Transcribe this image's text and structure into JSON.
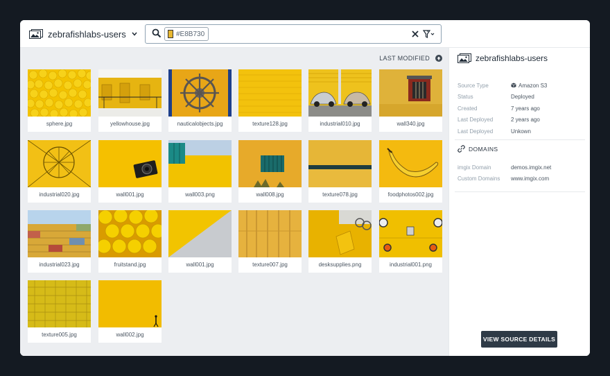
{
  "source": {
    "name": "zebrafishlabs-users",
    "switcher_icon": "images-icon"
  },
  "search": {
    "chip_label": "#E8B730",
    "chip_color": "#E8B730"
  },
  "sort": {
    "label": "LAST MODIFIED"
  },
  "images": [
    {
      "name": "sphere.jpg"
    },
    {
      "name": "yellowhouse.jpg"
    },
    {
      "name": "nauticalobjects.jpg"
    },
    {
      "name": "texture128.jpg"
    },
    {
      "name": "industrial010.jpg"
    },
    {
      "name": "wall340.jpg"
    },
    {
      "name": "industrial020.jpg"
    },
    {
      "name": "wall001.jpg"
    },
    {
      "name": "wall003.png"
    },
    {
      "name": "wall008.jpg"
    },
    {
      "name": "texture078.jpg"
    },
    {
      "name": "foodphotos002.jpg"
    },
    {
      "name": "industrial023.jpg"
    },
    {
      "name": "fruitstand.jpg"
    },
    {
      "name": "wall001.jpg"
    },
    {
      "name": "texture007.jpg"
    },
    {
      "name": "desksupplies.png"
    },
    {
      "name": "industrial001.png"
    },
    {
      "name": "texture005.jpg"
    },
    {
      "name": "wall002.jpg"
    }
  ],
  "details": {
    "title": "zebrafishlabs-users",
    "rows": [
      {
        "key": "Source Type",
        "value": "Amazon S3"
      },
      {
        "key": "Status",
        "value": "Deployed"
      },
      {
        "key": "Created",
        "value": "7 years ago"
      },
      {
        "key": "Last Deployed",
        "value": "2 years ago"
      },
      {
        "key": "Last Deployed",
        "value": "Unkown"
      }
    ],
    "domains_heading": "DOMAINS",
    "domains": [
      {
        "key": "imgix Domain",
        "value": "demos.imgix.net"
      },
      {
        "key": "Custom Domains",
        "value": "www.imgix.com"
      }
    ],
    "view_button": "VIEW SOURCE DETAILS"
  },
  "colors": {
    "accent_yellow": "#E8B730",
    "button_dark": "#2E3A46",
    "backdrop": "#141A22"
  }
}
